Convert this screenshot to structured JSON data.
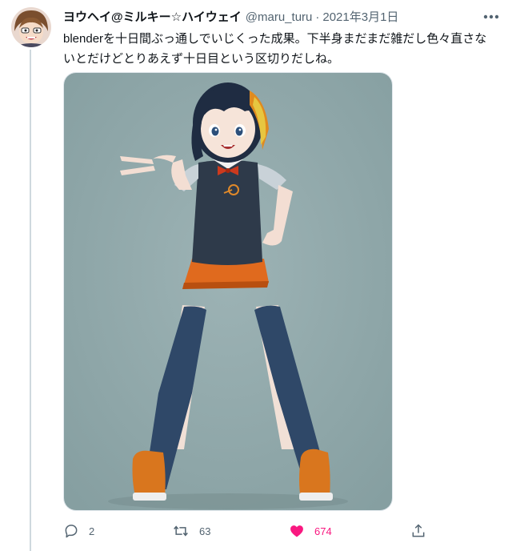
{
  "tweet": {
    "display_name": "ヨウヘイ@ミルキー☆ハイウェイ",
    "handle": "@maru_turu",
    "separator": "·",
    "date": "2021年3月1日",
    "text_line1": "blenderを十日間ぶっ通しでいじくった成果。下半身まだまだ雑だし色々直さな",
    "text_line2": "いとだけどとりあえず十日目という区切りだしね。"
  },
  "actions": {
    "reply_count": "2",
    "retweet_count": "63",
    "like_count": "674"
  },
  "icons": {
    "more": "more-dots-icon",
    "reply": "reply-icon",
    "retweet": "retweet-icon",
    "like": "heart-icon",
    "share": "share-icon"
  },
  "colors": {
    "secondary_text": "#536471",
    "like_active": "#f91880",
    "image_background": "#8fa8aa"
  }
}
